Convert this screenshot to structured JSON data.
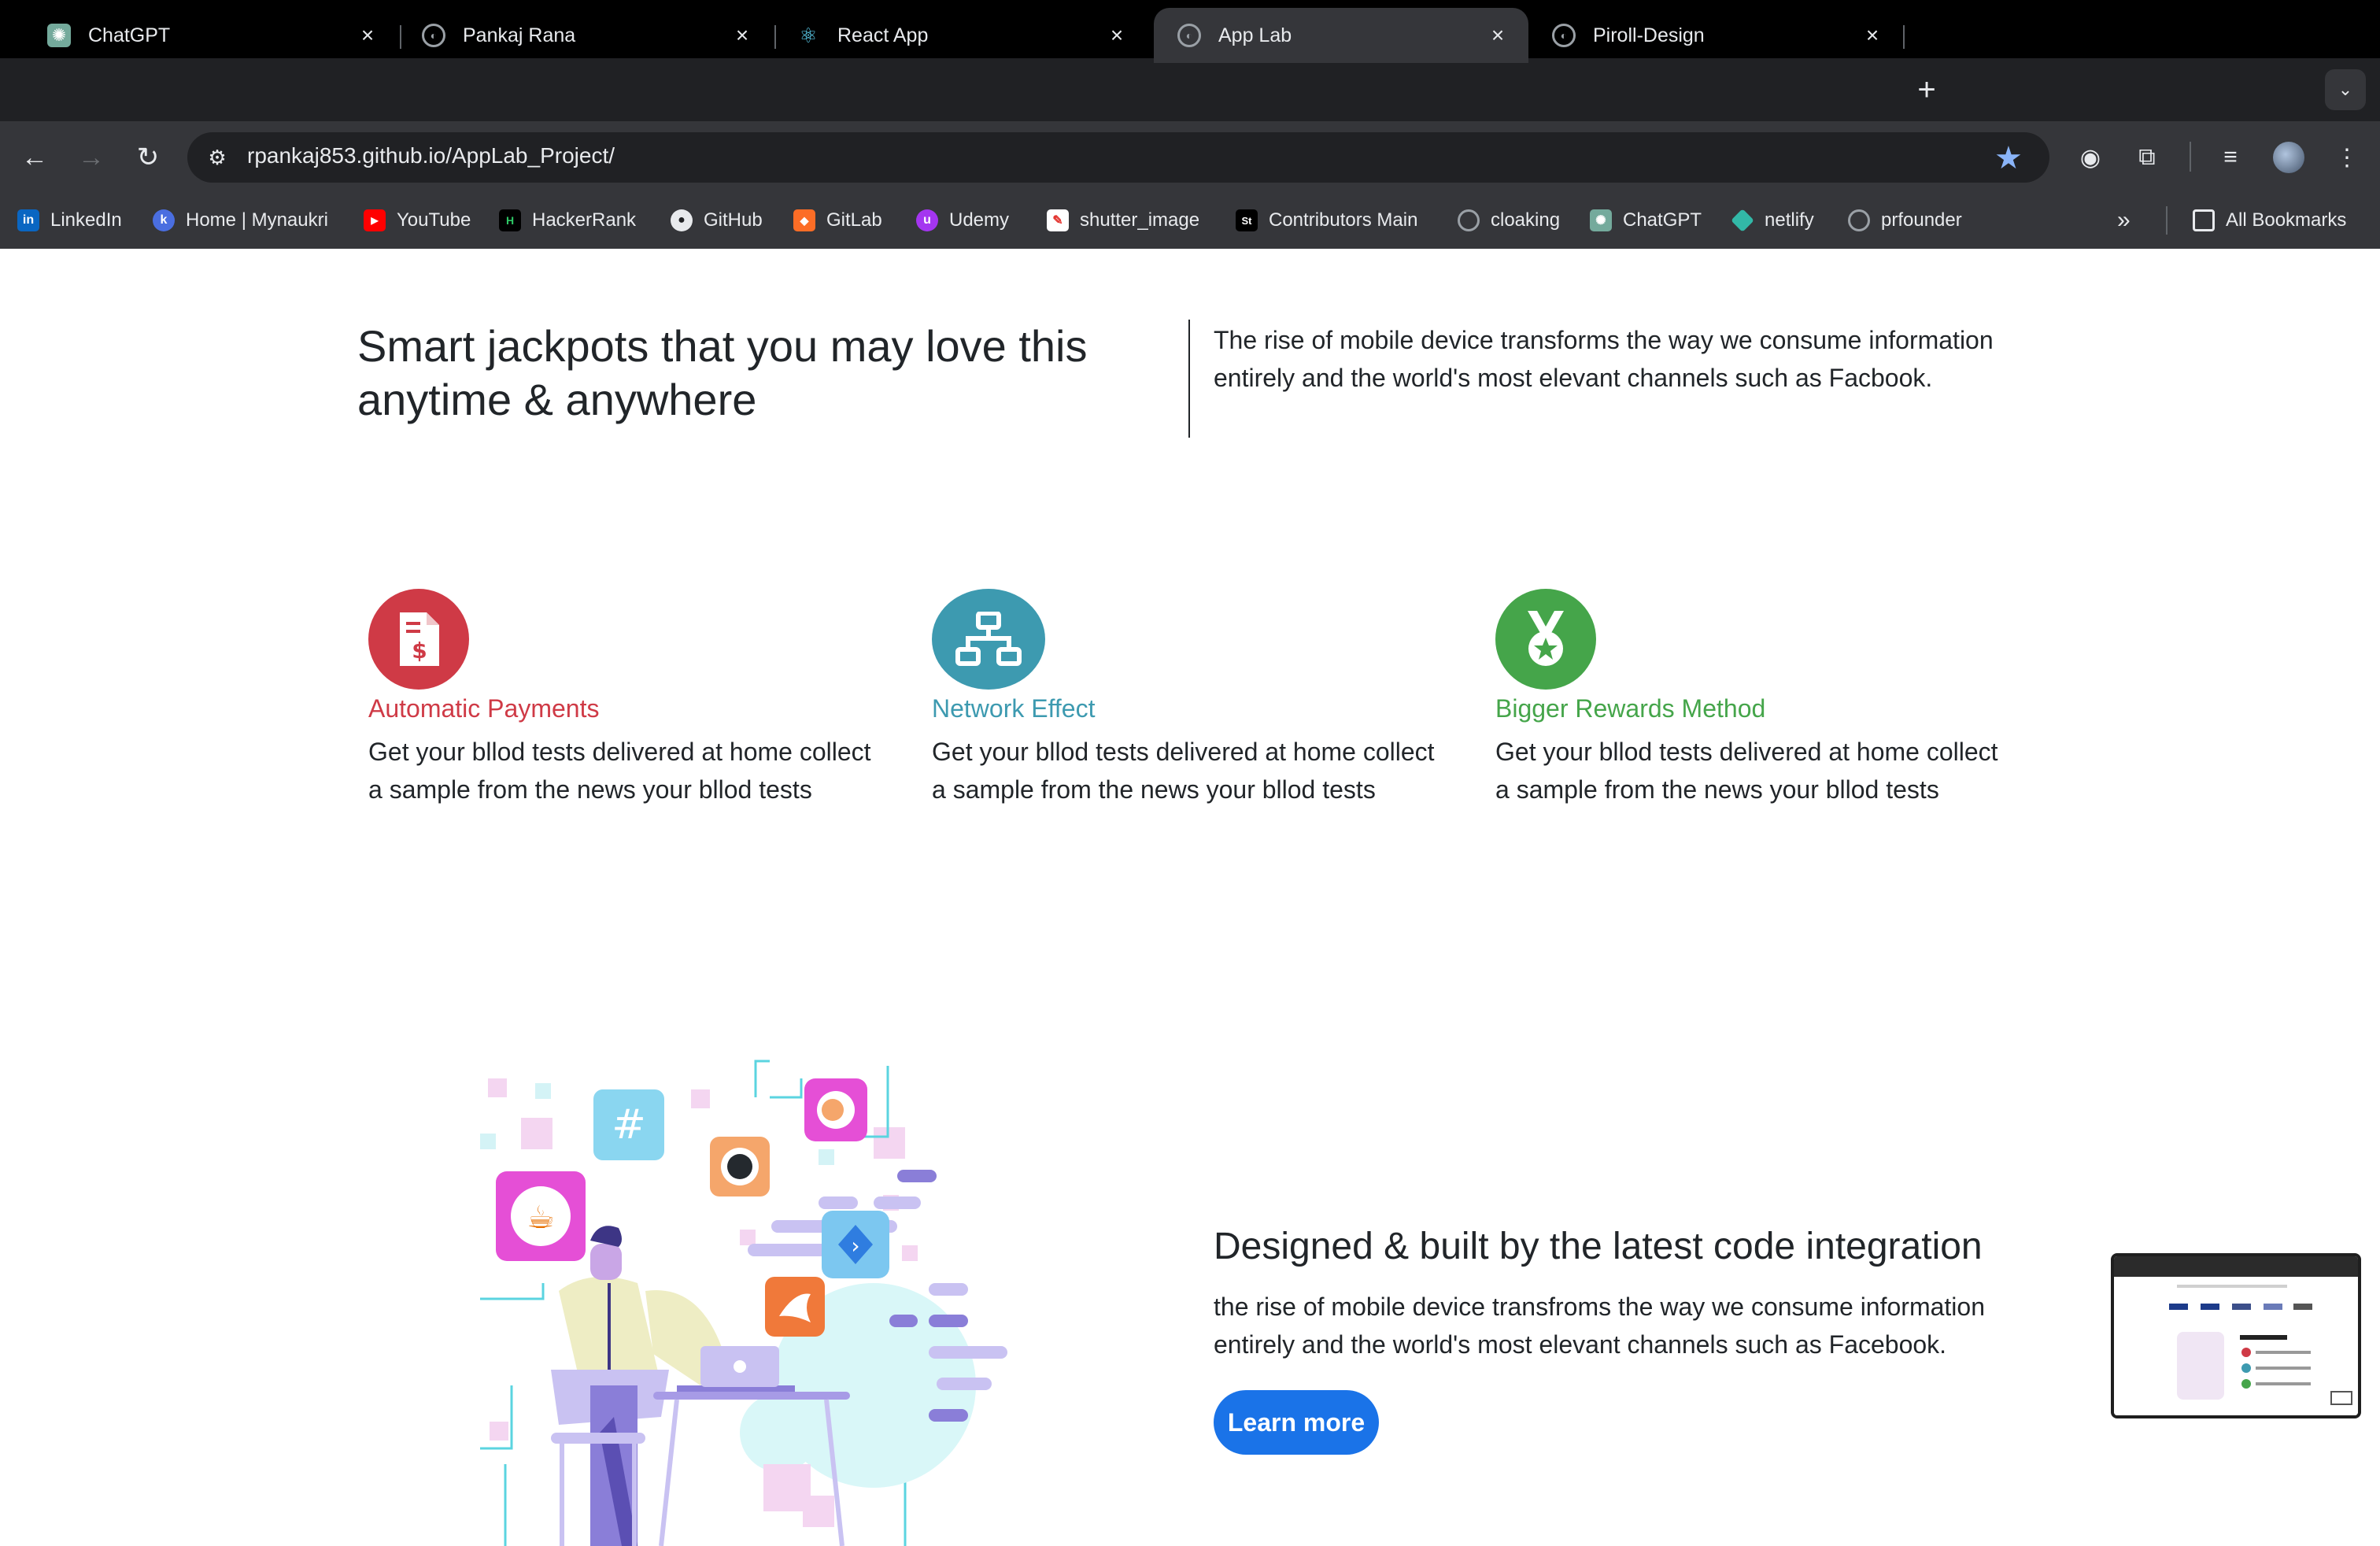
{
  "tabs": [
    {
      "title": "ChatGPT",
      "icon": "chatgpt-icon",
      "active": false
    },
    {
      "title": "Pankaj Rana",
      "icon": "globe-icon",
      "active": false
    },
    {
      "title": "React App",
      "icon": "react-icon",
      "active": false
    },
    {
      "title": "App Lab",
      "icon": "globe-icon",
      "active": true
    },
    {
      "title": "Piroll-Design",
      "icon": "globe-icon",
      "active": false
    }
  ],
  "address_bar": {
    "url": "rpankaj853.github.io/AppLab_Project/"
  },
  "bookmarks": {
    "items": [
      {
        "label": "LinkedIn",
        "icon": "linkedin-icon",
        "color": "#0a66c2"
      },
      {
        "label": "Home | Mynaukri",
        "icon": "mynaukri-icon",
        "color": "#4a6ee0"
      },
      {
        "label": "YouTube",
        "icon": "youtube-icon",
        "color": "#ff0000"
      },
      {
        "label": "HackerRank",
        "icon": "hackerrank-icon",
        "color": "#000000"
      },
      {
        "label": "GitHub",
        "icon": "github-icon",
        "color": "#e8eaed"
      },
      {
        "label": "GitLab",
        "icon": "gitlab-icon",
        "color": "#fc6d26"
      },
      {
        "label": "Udemy",
        "icon": "udemy-icon",
        "color": "#a435f0"
      },
      {
        "label": "shutter_image",
        "icon": "shutter-icon",
        "color": "#ffffff"
      },
      {
        "label": "Contributors Main",
        "icon": "contributors-icon",
        "color": "#000000"
      },
      {
        "label": "cloaking",
        "icon": "globe-icon",
        "color": "#9aa0a6"
      },
      {
        "label": "ChatGPT",
        "icon": "chatgpt-icon",
        "color": "#74aa9c"
      },
      {
        "label": "netlify",
        "icon": "netlify-icon",
        "color": "#32b8a7"
      },
      {
        "label": "prfounder",
        "icon": "globe-icon",
        "color": "#9aa0a6"
      }
    ],
    "all_bookmarks": "All Bookmarks"
  },
  "hero": {
    "title": "Smart jackpots that you may love this anytime & anywhere",
    "description": "The rise of mobile device transforms the way we consume information entirely and the world's most elevant channels such as Facbook."
  },
  "features": [
    {
      "title": "Automatic Payments",
      "description": "Get your bllod tests delivered at home collect a sample from the news your bllod tests",
      "color": "#cf3a46",
      "icon": "invoice-dollar-icon"
    },
    {
      "title": "Network Effect",
      "description": "Get your bllod tests delivered at home collect a sample from the news your bllod tests",
      "color": "#3d9ab0",
      "icon": "network-icon"
    },
    {
      "title": "Bigger Rewards Method",
      "description": "Get your bllod tests delivered at home collect a sample from the news your bllod tests",
      "color": "#45a54a",
      "icon": "medal-icon"
    }
  ],
  "cta": {
    "title": "Designed & built by the latest code integration",
    "description": "the rise of mobile device transfroms the way we consume information entirely and the world's most elevant channels such as Facebook.",
    "button_label": "Learn more",
    "button_color": "#1a73e8"
  }
}
